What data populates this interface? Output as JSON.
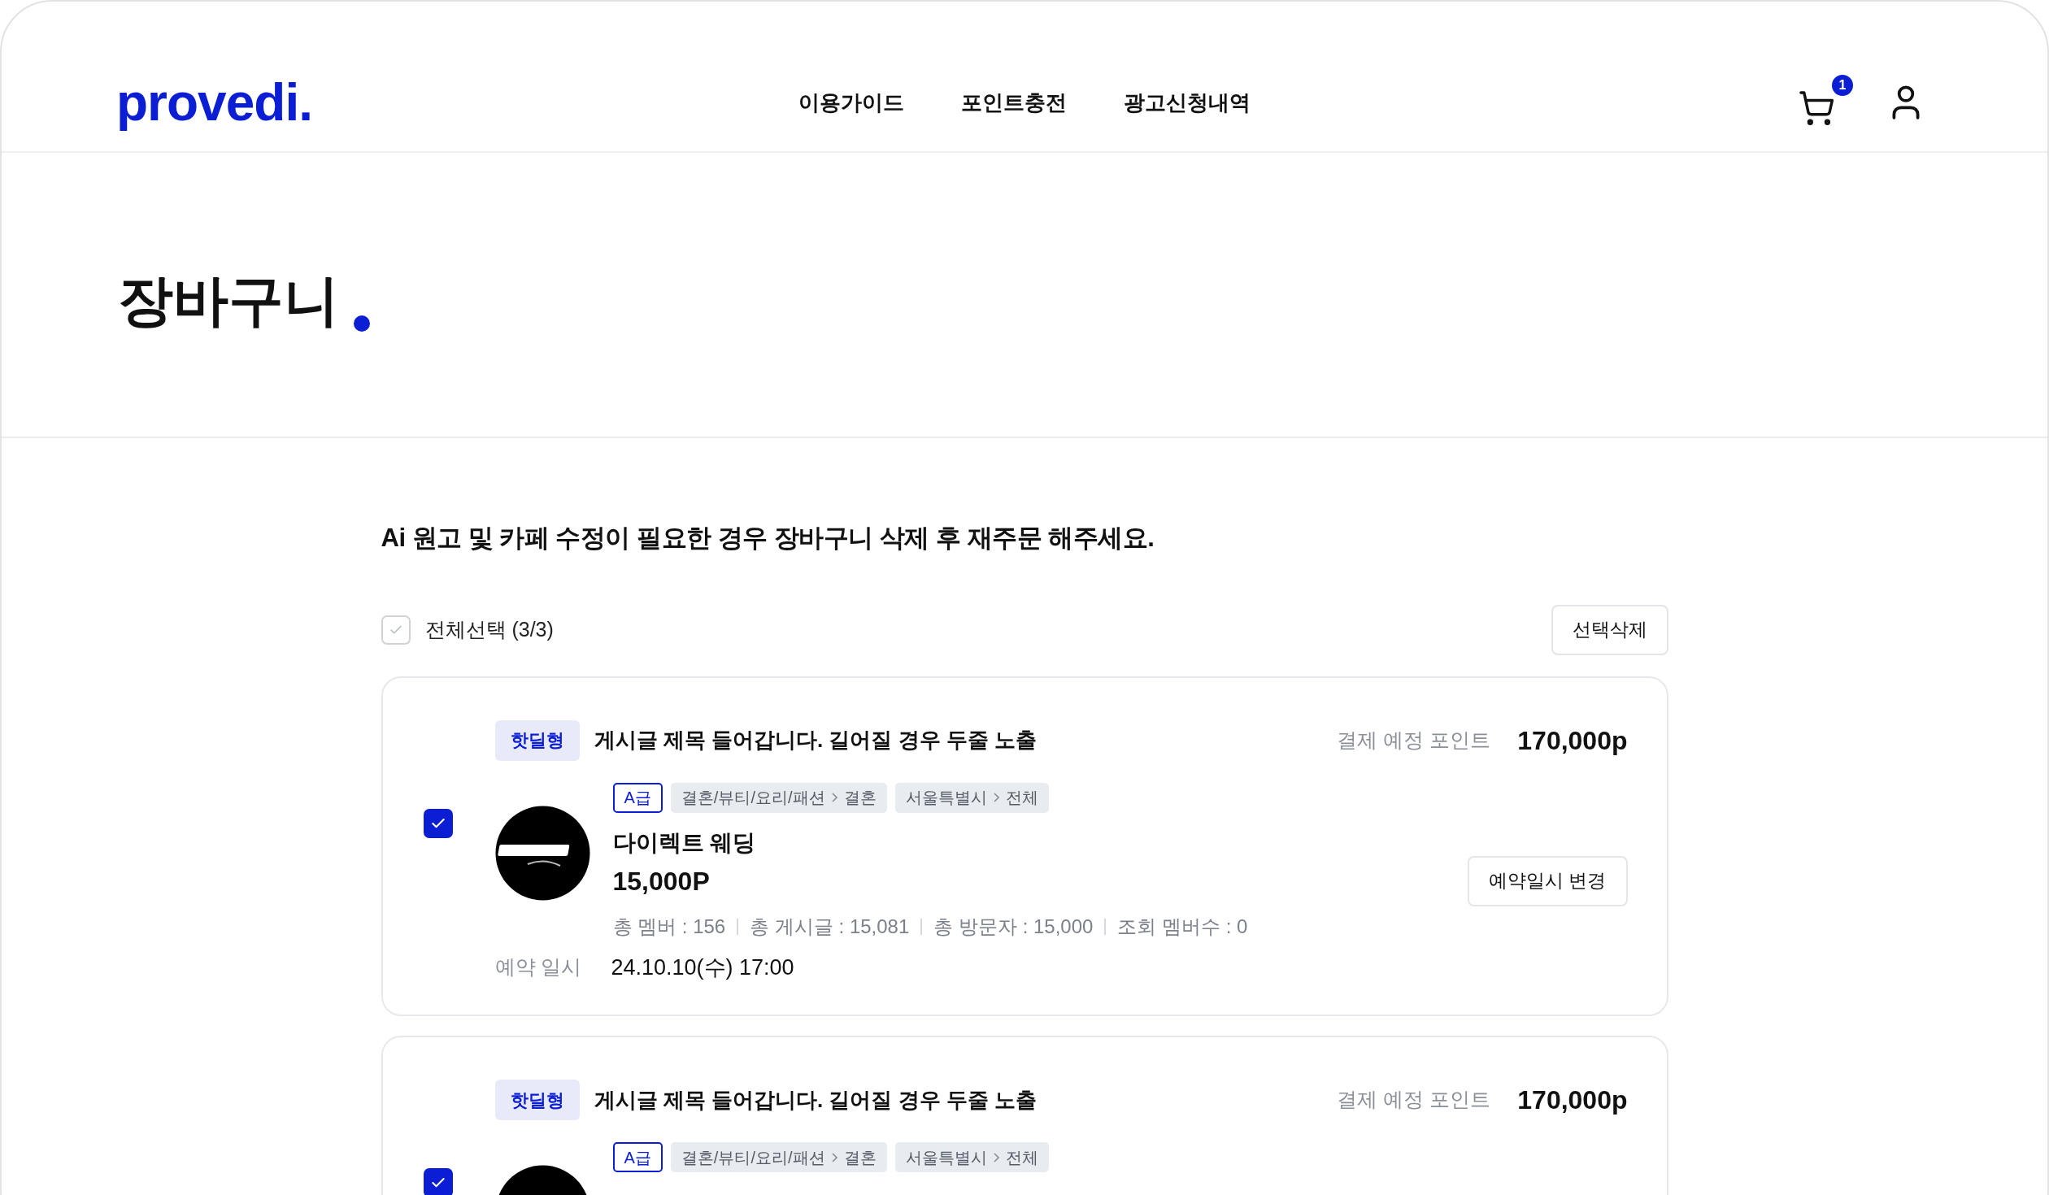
{
  "header": {
    "logo": "provedi.",
    "nav": [
      "이용가이드",
      "포인트충전",
      "광고신청내역"
    ],
    "cart_count": "1"
  },
  "page_title": "장바구니",
  "notice": "Ai 원고 및 카페 수정이 필요한 경우 장바구니 삭제 후 재주문 해주세요.",
  "select_all": {
    "label": "전체선택 (3/3)",
    "checked": false
  },
  "delete_button": "선택삭제",
  "items": [
    {
      "checked": true,
      "tag": "핫딜형",
      "title": "게시글 제목 들어갑니다. 길어질 경우 두줄 노출",
      "points_label": "결제 예정 포인트",
      "points": "170,000p",
      "grade": "A급",
      "category": [
        "결혼/뷰티/요리/패션",
        "결혼"
      ],
      "region": [
        "서울특별시",
        "전체"
      ],
      "name": "다이렉트 웨딩",
      "price": "15,000P",
      "stats": [
        "총 멤버 : 156",
        "총 게시글 : 15,081",
        "총 방문자 : 15,000",
        "조회 멤버수 :  0"
      ],
      "reserve_label": "예약 일시",
      "reserve_value": "24.10.10(수) 17:00",
      "change_button": "예약일시 변경"
    },
    {
      "checked": true,
      "tag": "핫딜형",
      "title": "게시글 제목 들어갑니다. 길어질 경우 두줄 노출",
      "points_label": "결제 예정 포인트",
      "points": "170,000p",
      "grade": "A급",
      "category": [
        "결혼/뷰티/요리/패션",
        "결혼"
      ],
      "region": [
        "서울특별시",
        "전체"
      ]
    }
  ]
}
